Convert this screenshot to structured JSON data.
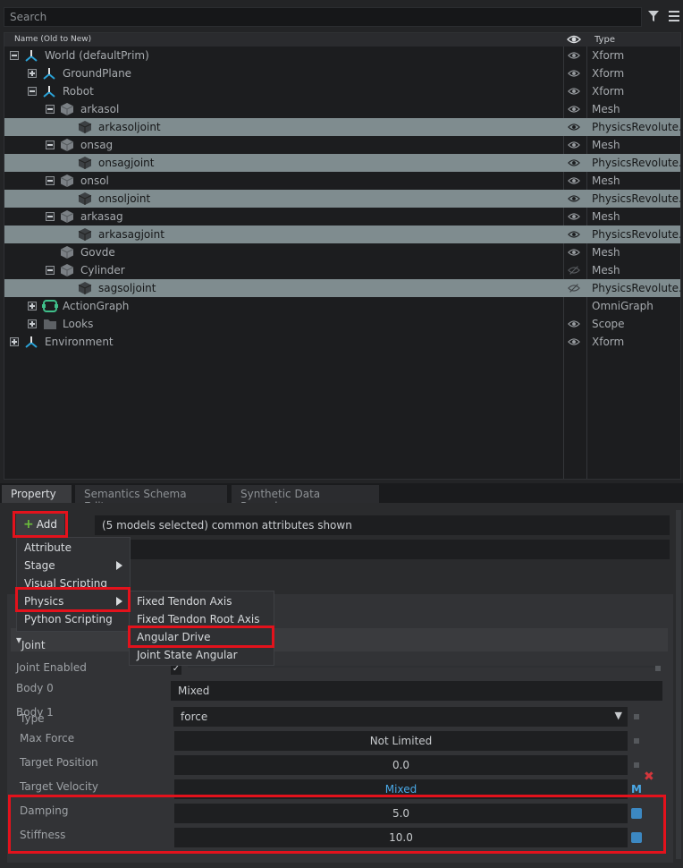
{
  "search": {
    "placeholder": "Search"
  },
  "stage": {
    "header_name": "Name (Old to New)",
    "header_type": "Type",
    "rows": [
      {
        "label": "World (defaultPrim)",
        "type": "Xform"
      },
      {
        "label": "GroundPlane",
        "type": "Xform"
      },
      {
        "label": "Robot",
        "type": "Xform"
      },
      {
        "label": "arkasol",
        "type": "Mesh"
      },
      {
        "label": "arkasoljoint",
        "type": "PhysicsRevolute..."
      },
      {
        "label": "onsag",
        "type": "Mesh"
      },
      {
        "label": "onsagjoint",
        "type": "PhysicsRevolute..."
      },
      {
        "label": "onsol",
        "type": "Mesh"
      },
      {
        "label": "onsoljoint",
        "type": "PhysicsRevolute..."
      },
      {
        "label": "arkasag",
        "type": "Mesh"
      },
      {
        "label": "arkasagjoint",
        "type": "PhysicsRevolute..."
      },
      {
        "label": "Govde",
        "type": "Mesh"
      },
      {
        "label": "Cylinder",
        "type": "Mesh"
      },
      {
        "label": "sagsoljoint",
        "type": "PhysicsRevolute..."
      },
      {
        "label": "ActionGraph",
        "type": "OmniGraph"
      },
      {
        "label": "Looks",
        "type": "Scope"
      },
      {
        "label": "Environment",
        "type": "Xform"
      }
    ]
  },
  "tabs": [
    "Property",
    "Semantics Schema Editor",
    "Synthetic Data Recorder"
  ],
  "property": {
    "add_label": "Add",
    "models_text": "(5 models selected) common attributes shown",
    "joint_section": "Joint",
    "joint_enabled_label": "Joint Enabled",
    "body0_label": "Body 0",
    "body0_value": "Mixed",
    "body1_label": "Body 1",
    "type_label": "Type",
    "type_value": "force",
    "max_force_label": "Max Force",
    "max_force_value": "Not Limited",
    "target_position_label": "Target Position",
    "target_position_value": "0.0",
    "target_velocity_label": "Target Velocity",
    "target_velocity_value": "Mixed",
    "mixed_badge": "M",
    "damping_label": "Damping",
    "damping_value": "5.0",
    "stiffness_label": "Stiffness",
    "stiffness_value": "10.0"
  },
  "menu": {
    "items": [
      "Attribute",
      "Stage",
      "Visual Scripting",
      "Physics",
      "Python Scripting"
    ]
  },
  "submenu": {
    "items": [
      "Fixed Tendon Axis",
      "Fixed Tendon Root Axis",
      "Angular Drive",
      "Joint State Angular"
    ]
  },
  "colors": {
    "highlight": "#e3121c",
    "selected_row": "#7f8c8f",
    "accent_blue": "#3c88c2"
  }
}
